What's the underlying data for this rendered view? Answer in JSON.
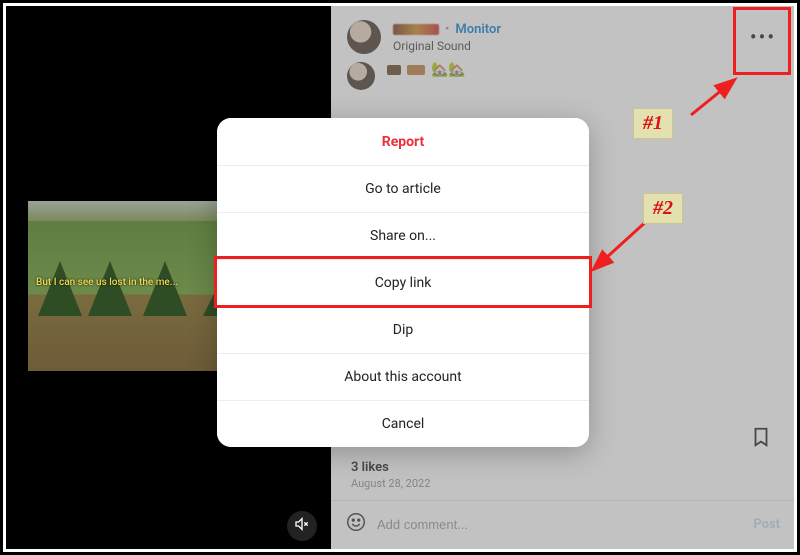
{
  "header": {
    "monitor_label": "Monitor",
    "separator": "•",
    "sound_label": "Original Sound"
  },
  "video": {
    "caption": "But I can see us lost in the me..."
  },
  "sheet": {
    "items": [
      {
        "key": "report",
        "label": "Report",
        "danger": true
      },
      {
        "key": "go-article",
        "label": "Go to article",
        "danger": false
      },
      {
        "key": "share-on",
        "label": "Share on...",
        "danger": false
      },
      {
        "key": "copy-link",
        "label": "Copy link",
        "danger": false
      },
      {
        "key": "dip",
        "label": "Dip",
        "danger": false
      },
      {
        "key": "about-acct",
        "label": "About this account",
        "danger": false
      },
      {
        "key": "cancel",
        "label": "Cancel",
        "danger": false
      }
    ]
  },
  "meta": {
    "likes_text": "3 likes",
    "date_text": "August 28, 2022"
  },
  "comment_box": {
    "placeholder": "Add comment...",
    "post_label": "Post"
  },
  "annotations": {
    "step1": "#1",
    "step2": "#2"
  }
}
